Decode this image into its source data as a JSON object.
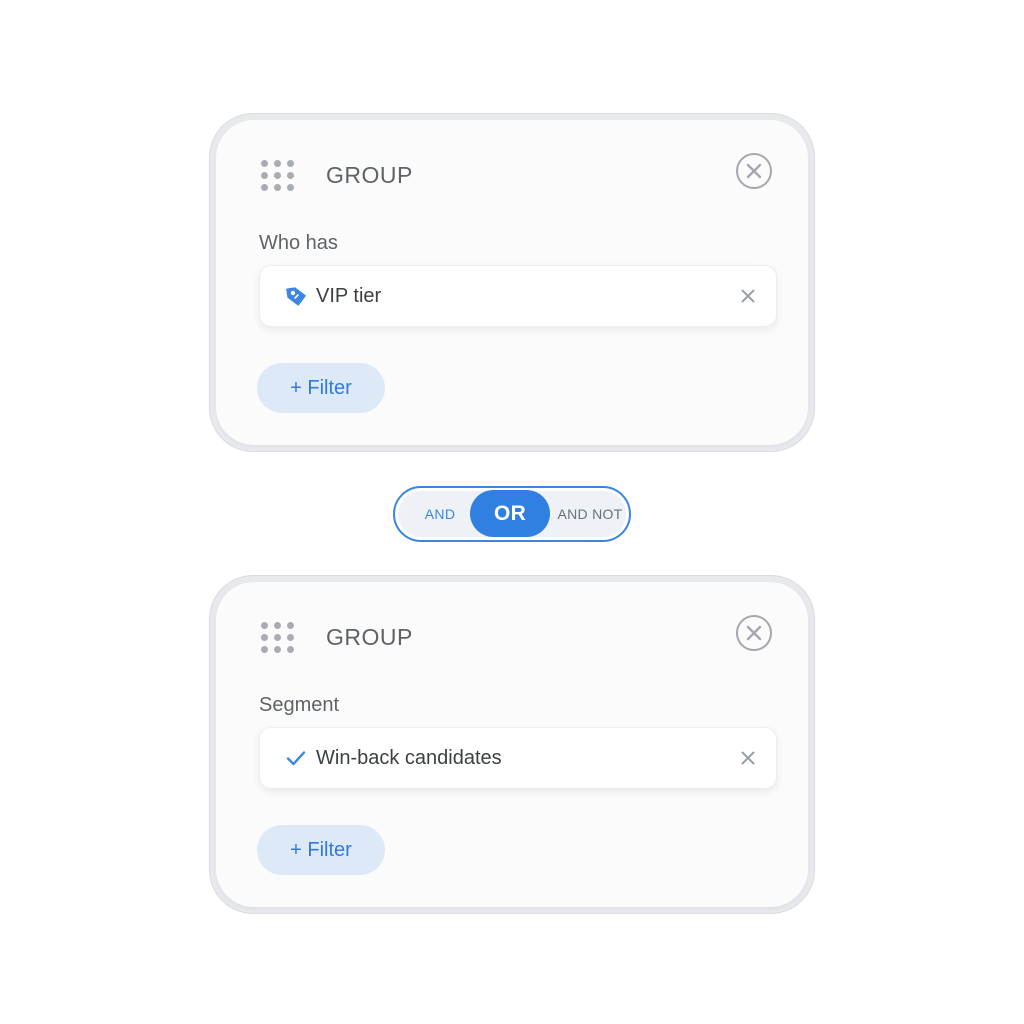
{
  "groups": [
    {
      "title": "GROUP",
      "field_label": "Who has",
      "value": "VIP tier",
      "value_icon": "tag-icon",
      "filter_button": "+ Filter"
    },
    {
      "title": "GROUP",
      "field_label": "Segment",
      "value": "Win-back candidates",
      "value_icon": "check-icon",
      "filter_button": "+ Filter"
    }
  ],
  "logic_toggle": {
    "options": [
      "AND",
      "OR",
      "AND NOT"
    ],
    "selected": "OR"
  },
  "colors": {
    "accent": "#2f80e0",
    "filter_bg": "#dde9f7",
    "muted_icon": "#a4a8ae"
  }
}
